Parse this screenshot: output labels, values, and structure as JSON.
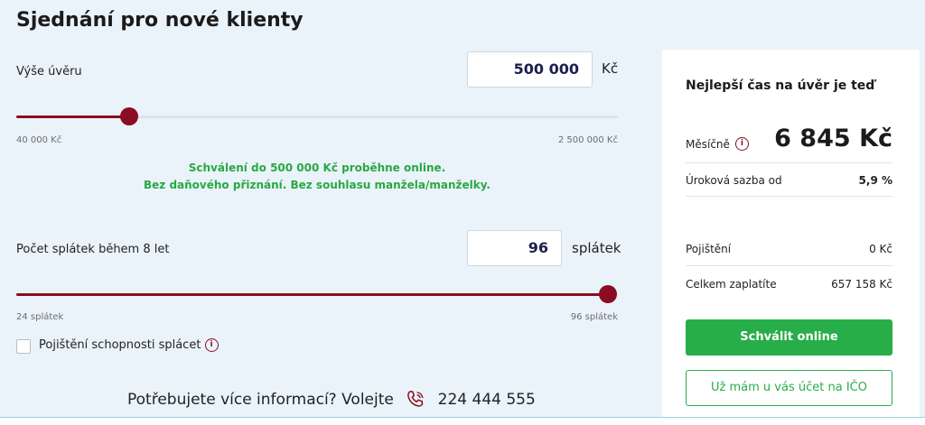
{
  "page_title": "Sjednání pro nové klienty",
  "loan": {
    "label": "Výše úvěru",
    "value": "500 000",
    "unit": "Kč",
    "min_label": "40 000 Kč",
    "max_label": "2 500 000 Kč",
    "min": 40000,
    "max": 2500000,
    "current": 500000
  },
  "notice": {
    "line1": "Schválení do 500 000 Kč proběhne online.",
    "line2": "Bez daňového přiznání. Bez souhlasu manžela/manželky."
  },
  "installments": {
    "label": "Počet splátek během 8 let",
    "value": "96",
    "unit": "splátek",
    "min_label": "24 splátek",
    "max_label": "96 splátek",
    "min": 24,
    "max": 96,
    "current": 96
  },
  "insurance_checkbox": {
    "label": "Pojištění schopnosti splácet",
    "checked": false
  },
  "contact": {
    "text": "Potřebujete více informací? Volejte",
    "phone": "224 444 555"
  },
  "summary": {
    "title": "Nejlepší čas na úvěr je teď",
    "monthly_label": "Měsíčně",
    "monthly_value": "6 845 Kč",
    "rate_label": "Úroková sazba od",
    "rate_value": "5,9 %",
    "insurance_label": "Pojištění",
    "insurance_value": "0 Kč",
    "total_label": "Celkem zaplatíte",
    "total_value": "657 158 Kč",
    "approve_button": "Schválit online",
    "existing_account_button": "Už mám u vás účet na IČO"
  },
  "colors": {
    "accent": "#8b0c23",
    "success": "#27ae49",
    "background": "#eaf3fa"
  }
}
